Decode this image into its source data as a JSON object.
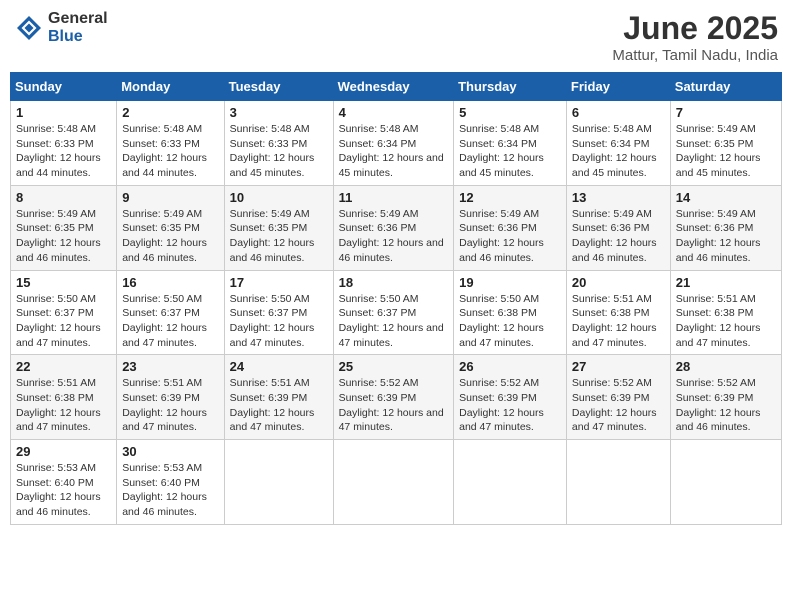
{
  "header": {
    "logo_general": "General",
    "logo_blue": "Blue",
    "title": "June 2025",
    "location": "Mattur, Tamil Nadu, India"
  },
  "columns": [
    "Sunday",
    "Monday",
    "Tuesday",
    "Wednesday",
    "Thursday",
    "Friday",
    "Saturday"
  ],
  "weeks": [
    [
      {
        "day": "1",
        "sunrise": "Sunrise: 5:48 AM",
        "sunset": "Sunset: 6:33 PM",
        "daylight": "Daylight: 12 hours and 44 minutes."
      },
      {
        "day": "2",
        "sunrise": "Sunrise: 5:48 AM",
        "sunset": "Sunset: 6:33 PM",
        "daylight": "Daylight: 12 hours and 44 minutes."
      },
      {
        "day": "3",
        "sunrise": "Sunrise: 5:48 AM",
        "sunset": "Sunset: 6:33 PM",
        "daylight": "Daylight: 12 hours and 45 minutes."
      },
      {
        "day": "4",
        "sunrise": "Sunrise: 5:48 AM",
        "sunset": "Sunset: 6:34 PM",
        "daylight": "Daylight: 12 hours and 45 minutes."
      },
      {
        "day": "5",
        "sunrise": "Sunrise: 5:48 AM",
        "sunset": "Sunset: 6:34 PM",
        "daylight": "Daylight: 12 hours and 45 minutes."
      },
      {
        "day": "6",
        "sunrise": "Sunrise: 5:48 AM",
        "sunset": "Sunset: 6:34 PM",
        "daylight": "Daylight: 12 hours and 45 minutes."
      },
      {
        "day": "7",
        "sunrise": "Sunrise: 5:49 AM",
        "sunset": "Sunset: 6:35 PM",
        "daylight": "Daylight: 12 hours and 45 minutes."
      }
    ],
    [
      {
        "day": "8",
        "sunrise": "Sunrise: 5:49 AM",
        "sunset": "Sunset: 6:35 PM",
        "daylight": "Daylight: 12 hours and 46 minutes."
      },
      {
        "day": "9",
        "sunrise": "Sunrise: 5:49 AM",
        "sunset": "Sunset: 6:35 PM",
        "daylight": "Daylight: 12 hours and 46 minutes."
      },
      {
        "day": "10",
        "sunrise": "Sunrise: 5:49 AM",
        "sunset": "Sunset: 6:35 PM",
        "daylight": "Daylight: 12 hours and 46 minutes."
      },
      {
        "day": "11",
        "sunrise": "Sunrise: 5:49 AM",
        "sunset": "Sunset: 6:36 PM",
        "daylight": "Daylight: 12 hours and 46 minutes."
      },
      {
        "day": "12",
        "sunrise": "Sunrise: 5:49 AM",
        "sunset": "Sunset: 6:36 PM",
        "daylight": "Daylight: 12 hours and 46 minutes."
      },
      {
        "day": "13",
        "sunrise": "Sunrise: 5:49 AM",
        "sunset": "Sunset: 6:36 PM",
        "daylight": "Daylight: 12 hours and 46 minutes."
      },
      {
        "day": "14",
        "sunrise": "Sunrise: 5:49 AM",
        "sunset": "Sunset: 6:36 PM",
        "daylight": "Daylight: 12 hours and 46 minutes."
      }
    ],
    [
      {
        "day": "15",
        "sunrise": "Sunrise: 5:50 AM",
        "sunset": "Sunset: 6:37 PM",
        "daylight": "Daylight: 12 hours and 47 minutes."
      },
      {
        "day": "16",
        "sunrise": "Sunrise: 5:50 AM",
        "sunset": "Sunset: 6:37 PM",
        "daylight": "Daylight: 12 hours and 47 minutes."
      },
      {
        "day": "17",
        "sunrise": "Sunrise: 5:50 AM",
        "sunset": "Sunset: 6:37 PM",
        "daylight": "Daylight: 12 hours and 47 minutes."
      },
      {
        "day": "18",
        "sunrise": "Sunrise: 5:50 AM",
        "sunset": "Sunset: 6:37 PM",
        "daylight": "Daylight: 12 hours and 47 minutes."
      },
      {
        "day": "19",
        "sunrise": "Sunrise: 5:50 AM",
        "sunset": "Sunset: 6:38 PM",
        "daylight": "Daylight: 12 hours and 47 minutes."
      },
      {
        "day": "20",
        "sunrise": "Sunrise: 5:51 AM",
        "sunset": "Sunset: 6:38 PM",
        "daylight": "Daylight: 12 hours and 47 minutes."
      },
      {
        "day": "21",
        "sunrise": "Sunrise: 5:51 AM",
        "sunset": "Sunset: 6:38 PM",
        "daylight": "Daylight: 12 hours and 47 minutes."
      }
    ],
    [
      {
        "day": "22",
        "sunrise": "Sunrise: 5:51 AM",
        "sunset": "Sunset: 6:38 PM",
        "daylight": "Daylight: 12 hours and 47 minutes."
      },
      {
        "day": "23",
        "sunrise": "Sunrise: 5:51 AM",
        "sunset": "Sunset: 6:39 PM",
        "daylight": "Daylight: 12 hours and 47 minutes."
      },
      {
        "day": "24",
        "sunrise": "Sunrise: 5:51 AM",
        "sunset": "Sunset: 6:39 PM",
        "daylight": "Daylight: 12 hours and 47 minutes."
      },
      {
        "day": "25",
        "sunrise": "Sunrise: 5:52 AM",
        "sunset": "Sunset: 6:39 PM",
        "daylight": "Daylight: 12 hours and 47 minutes."
      },
      {
        "day": "26",
        "sunrise": "Sunrise: 5:52 AM",
        "sunset": "Sunset: 6:39 PM",
        "daylight": "Daylight: 12 hours and 47 minutes."
      },
      {
        "day": "27",
        "sunrise": "Sunrise: 5:52 AM",
        "sunset": "Sunset: 6:39 PM",
        "daylight": "Daylight: 12 hours and 47 minutes."
      },
      {
        "day": "28",
        "sunrise": "Sunrise: 5:52 AM",
        "sunset": "Sunset: 6:39 PM",
        "daylight": "Daylight: 12 hours and 46 minutes."
      }
    ],
    [
      {
        "day": "29",
        "sunrise": "Sunrise: 5:53 AM",
        "sunset": "Sunset: 6:40 PM",
        "daylight": "Daylight: 12 hours and 46 minutes."
      },
      {
        "day": "30",
        "sunrise": "Sunrise: 5:53 AM",
        "sunset": "Sunset: 6:40 PM",
        "daylight": "Daylight: 12 hours and 46 minutes."
      },
      null,
      null,
      null,
      null,
      null
    ]
  ]
}
